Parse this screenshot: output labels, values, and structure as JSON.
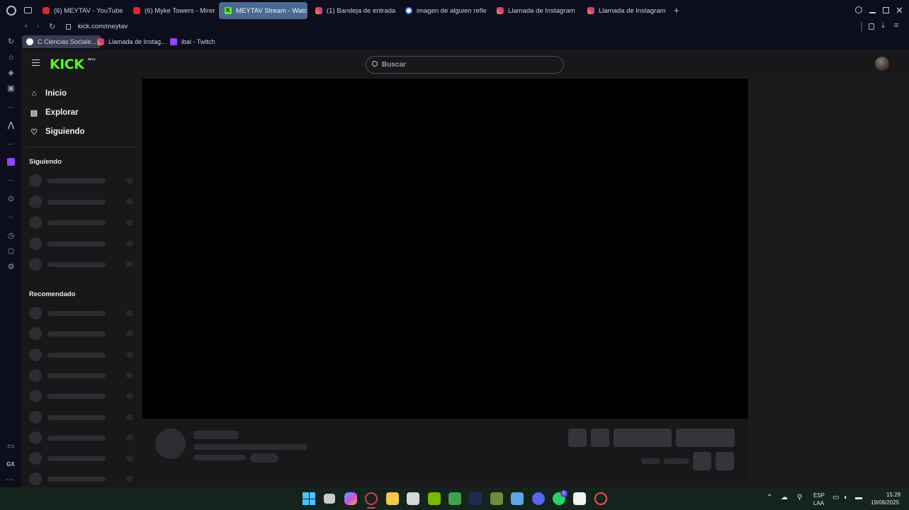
{
  "browser": {
    "tabs": [
      {
        "label": "(6) MEYTAV - YouTube",
        "icon": "youtube-icon",
        "active": false
      },
      {
        "label": "(6) Myke Towers - Mirer",
        "icon": "youtube-icon",
        "active": false
      },
      {
        "label": "MEYTAV Stream - Watch",
        "icon": "kick-icon",
        "active": true
      },
      {
        "label": "(1) Bandeja de entrada •",
        "icon": "instagram-icon",
        "active": false
      },
      {
        "label": "imagen de alguien refle",
        "icon": "google-icon",
        "active": false
      },
      {
        "label": "Llamada de Instagram",
        "icon": "instagram-icon",
        "active": false
      },
      {
        "label": "Llamada de Instagram",
        "icon": "instagram-icon",
        "active": false
      }
    ],
    "new_tab_symbol": "+",
    "url": "kick.com/meytav",
    "bookmarks": [
      {
        "label": "C Ciencias Sociale...",
        "icon": "google-icon"
      },
      {
        "label": "Llamada de Instag...",
        "icon": "instagram-icon"
      },
      {
        "label": "ibai - Twitch",
        "icon": "twitch-icon"
      }
    ],
    "sidebar_bottom_label": "GX",
    "sidebar_more": "···"
  },
  "kick": {
    "logo": "KICK",
    "logo_badge": "BETA",
    "search_placeholder": "Buscar",
    "nav": [
      {
        "label": "Inicio",
        "icon": "home-icon"
      },
      {
        "label": "Explorar",
        "icon": "explore-icon"
      },
      {
        "label": "Siguiendo",
        "icon": "heart-icon"
      }
    ],
    "following_title": "Siguiendo",
    "recommended_title": "Recomendado"
  },
  "taskbar": {
    "lang_top": "ESP",
    "lang_bottom": "LAA",
    "time": "15:28",
    "date": "19/08/2025",
    "badge_count": "5"
  },
  "colors": {
    "kick_green": "#53fc18",
    "active_tab": "#4a6a92",
    "background": "#18181b"
  }
}
